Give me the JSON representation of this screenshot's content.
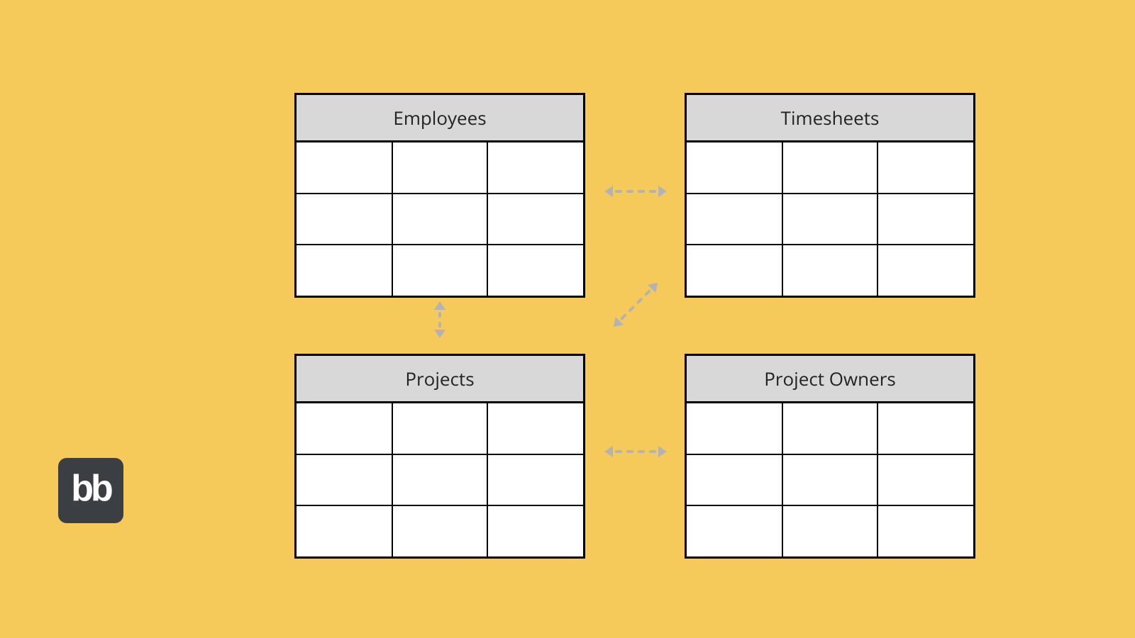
{
  "tables": {
    "employees": {
      "title": "Employees"
    },
    "timesheets": {
      "title": "Timesheets"
    },
    "projects": {
      "title": "Projects"
    },
    "project_owners": {
      "title": "Project Owners"
    }
  },
  "grid": {
    "rows": 3,
    "cols": 3
  },
  "relations": [
    {
      "from": "employees",
      "to": "timesheets",
      "style": "dashed-bidirectional"
    },
    {
      "from": "employees",
      "to": "projects",
      "style": "dashed-bidirectional"
    },
    {
      "from": "projects",
      "to": "project_owners",
      "style": "dashed-bidirectional"
    },
    {
      "from": "projects",
      "to": "timesheets",
      "style": "dashed-bidirectional-diagonal"
    }
  ],
  "logo": {
    "text": "bb"
  },
  "colors": {
    "background": "#f5ca5a",
    "table_header": "#d8d8d8",
    "table_border": "#000000",
    "arrow": "#b3b3b3",
    "logo_bg": "#3b3f44",
    "logo_fg": "#ffffff"
  }
}
